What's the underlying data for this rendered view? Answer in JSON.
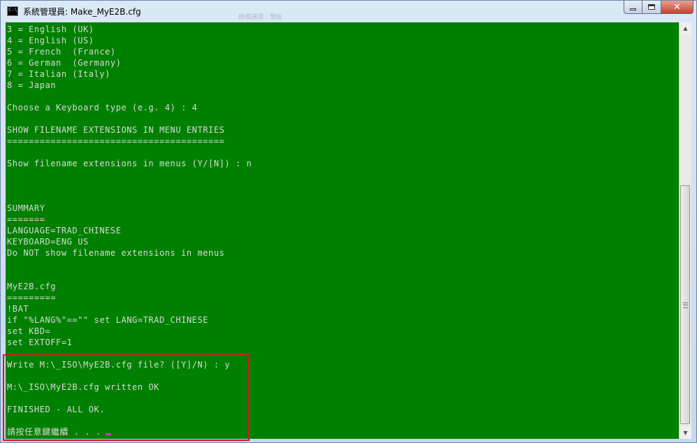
{
  "window": {
    "title": "系統管理員: Make_MyE2B.cfg",
    "app_icon_text": "C:\\",
    "ghost_text": "檢視選項 - 預設"
  },
  "console": {
    "lines": [
      "3 = English (UK)",
      "4 = English (US)",
      "5 = French  (France)",
      "6 = German  (Germany)",
      "7 = Italian (Italy)",
      "8 = Japan",
      "",
      "Choose a Keyboard type (e.g. 4) : 4",
      "",
      "SHOW FILENAME EXTENSIONS IN MENU ENTRIES",
      "========================================",
      "",
      "Show filename extensions in menus (Y/[N]) : n",
      "",
      "",
      "",
      "SUMMARY",
      "=======",
      "LANGUAGE=TRAD_CHINESE",
      "KEYBOARD=ENG US",
      "Do NOT show filename extensions in menus",
      "",
      "",
      "MyE2B.cfg",
      "=========",
      "!BAT",
      "if \"%LANG%\"==\"\" set LANG=TRAD_CHINESE",
      "set KBD=",
      "set EXTOFF=1",
      "",
      "Write M:\\_ISO\\MyE2B.cfg file? ([Y]/N) : y",
      "",
      "M:\\_ISO\\MyE2B.cfg written OK",
      "",
      "FINISHED - ALL OK.",
      "",
      "請按任意鍵繼續 . . ."
    ]
  },
  "colors": {
    "console_bg": "#008000",
    "console_fg": "#d8d8d8",
    "highlight_border": "#e0102a",
    "cursor": "#c040c0"
  },
  "icons": {
    "minimize": "minimize-icon",
    "maximize": "maximize-icon",
    "close": "close-icon",
    "app": "cmd-console-icon"
  }
}
